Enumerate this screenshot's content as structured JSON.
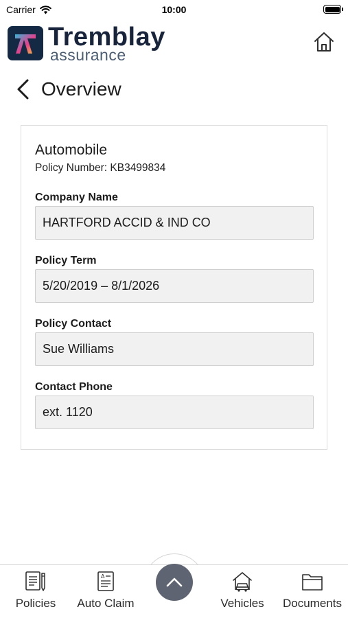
{
  "status_bar": {
    "carrier": "Carrier",
    "time": "10:00"
  },
  "header": {
    "brand_name": "Tremblay",
    "brand_sub": "assurance"
  },
  "page": {
    "title": "Overview"
  },
  "policy": {
    "type": "Automobile",
    "number_line": "Policy Number: KB3499834",
    "fields": [
      {
        "label": "Company Name",
        "value": "HARTFORD ACCID & IND CO"
      },
      {
        "label": "Policy Term",
        "value": "5/20/2019 – 8/1/2026"
      },
      {
        "label": "Policy Contact",
        "value": "Sue Williams"
      },
      {
        "label": "Contact Phone",
        "value": "ext. 1120"
      }
    ]
  },
  "tabbar": {
    "tabs": [
      {
        "label": "Policies",
        "icon": "policies-document-icon"
      },
      {
        "label": "Auto Claim",
        "icon": "auto-claim-form-icon"
      },
      {
        "label": "Vehicles",
        "icon": "vehicles-car-house-icon"
      },
      {
        "label": "Documents",
        "icon": "documents-folder-icon"
      }
    ],
    "center_button_icon": "chevron-up-icon"
  },
  "colors": {
    "brand_navy": "#17243b",
    "logo_background": "#142a44",
    "logo_gradient": [
      "#35b6d8",
      "#e83e8c",
      "#f2c23a"
    ],
    "field_background": "#f1f1f1",
    "fab_background": "#5e6471"
  }
}
